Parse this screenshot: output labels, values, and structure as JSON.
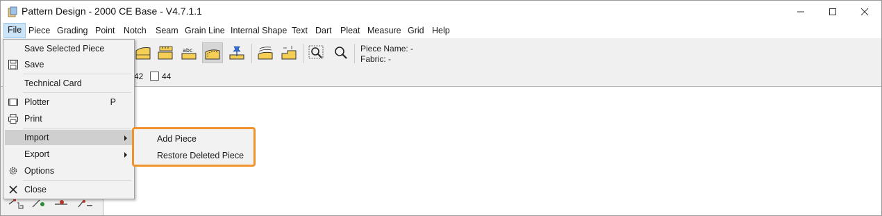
{
  "window": {
    "title": "Pattern Design - 2000 CE Base - V4.7.1.1"
  },
  "titlebar_controls": {
    "minimize_icon": "minimize-icon",
    "maximize_icon": "maximize-icon",
    "close_icon": "close-icon"
  },
  "menubar": {
    "items": [
      "File",
      "Piece",
      "Grading",
      "Point",
      "Notch",
      "Seam",
      "Grain Line",
      "Internal Shape",
      "Text",
      "Dart",
      "Pleat",
      "Measure",
      "Grid",
      "Help"
    ],
    "active": "File"
  },
  "toolbar": {
    "icons": [
      "piece-shape-icon",
      "piece-measure-icon",
      "piece-text-icon",
      "piece-seam-icon",
      "piece-pin-icon",
      "piece-stack-icon",
      "piece-step-icon",
      "zoom-window-icon",
      "zoom-icon"
    ],
    "pressed": "piece-seam-icon",
    "info": {
      "piece_name": "Piece Name: -",
      "fabric": "Fabric: -"
    },
    "sizes": [
      "42",
      "44"
    ]
  },
  "file_menu": {
    "items": [
      {
        "label": "Save Selected Piece",
        "icon": "",
        "shortcut": ""
      },
      {
        "label": "Save",
        "icon": "floppy-disk-icon",
        "shortcut": ""
      },
      {
        "label": "Technical Card",
        "icon": "",
        "shortcut": ""
      },
      {
        "label": "Plotter",
        "icon": "plotter-icon",
        "shortcut": "P"
      },
      {
        "label": "Print",
        "icon": "printer-icon",
        "shortcut": ""
      },
      {
        "label": "Import",
        "icon": "",
        "shortcut": "",
        "submenu": true
      },
      {
        "label": "Export",
        "icon": "",
        "shortcut": "",
        "submenu": true
      },
      {
        "label": "Options",
        "icon": "gear-icon",
        "shortcut": ""
      },
      {
        "label": "Close",
        "icon": "close-x-icon",
        "shortcut": ""
      }
    ],
    "highlighted": "Import"
  },
  "import_submenu": {
    "items": [
      "Add Piece",
      "Restore Deleted Piece"
    ],
    "highlight_color": "#f0932b"
  },
  "colors": {
    "accent_orange": "#f0932b",
    "menu_hover": "#cfcfcf",
    "menubar_active": "#cce4f7",
    "icon_yellow": "#f5cf55"
  }
}
